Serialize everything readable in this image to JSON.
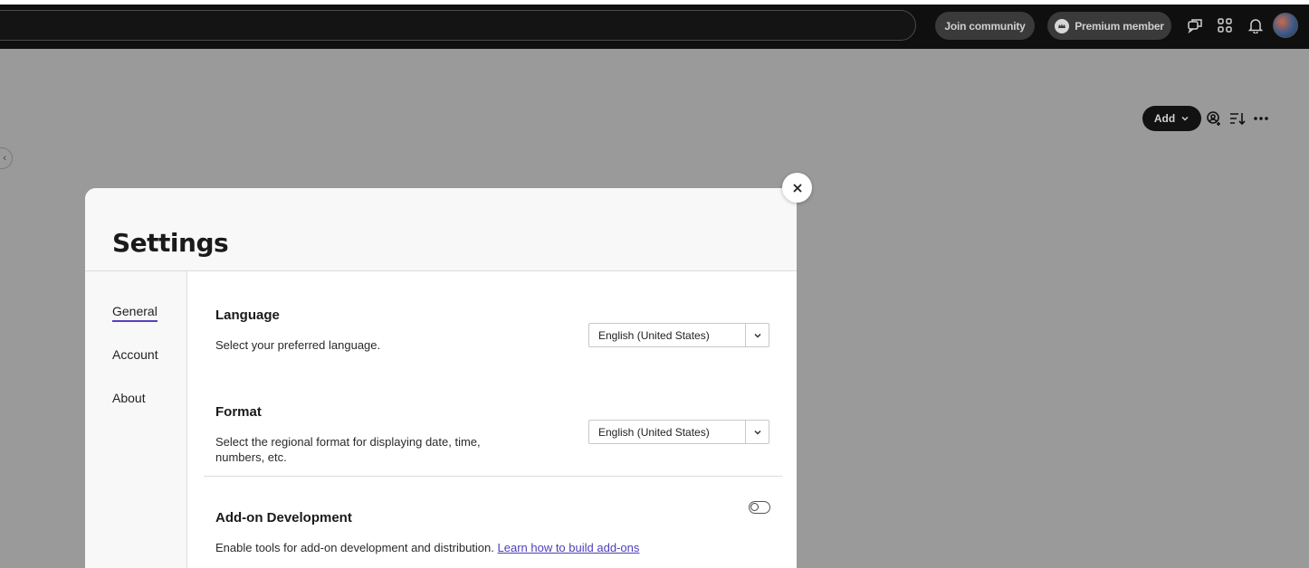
{
  "topbar": {
    "join_label": "Join community",
    "premium_label": "Premium member"
  },
  "toolbar": {
    "add_label": "Add"
  },
  "modal": {
    "title": "Settings",
    "nav": [
      {
        "label": "General",
        "active": true
      },
      {
        "label": "Account",
        "active": false
      },
      {
        "label": "About",
        "active": false
      }
    ],
    "language": {
      "title": "Language",
      "description": "Select your preferred language.",
      "value": "English (United States)"
    },
    "format": {
      "title": "Format",
      "description_line1": "Select the regional format for displaying date, time,",
      "description_line2": "numbers, etc.",
      "value": "English (United States)"
    },
    "addon": {
      "title": "Add-on Development",
      "description": "Enable tools for add-on development and distribution.",
      "link_label": "Learn how to build add-ons",
      "enabled": false
    }
  },
  "colors": {
    "accent": "#5a3fc0",
    "link": "#4b3fb8",
    "overlay": "#9a9a9a"
  }
}
